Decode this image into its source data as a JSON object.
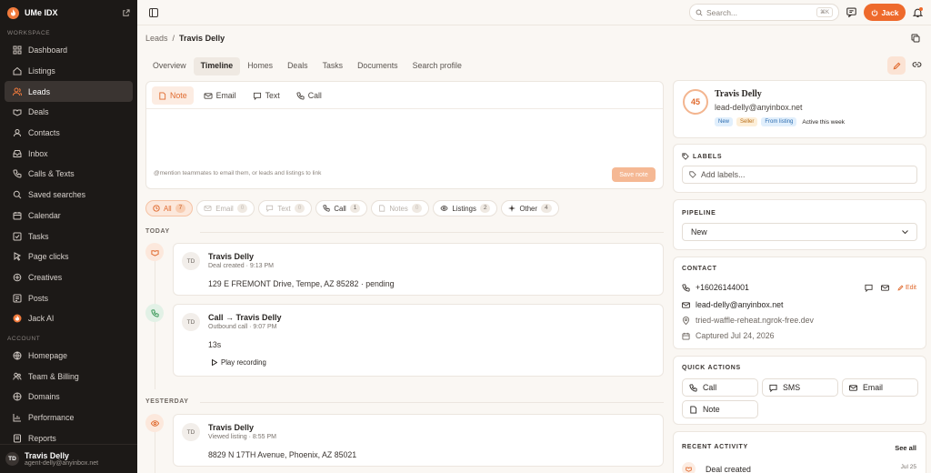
{
  "app": {
    "name": "UMe IDX"
  },
  "sidebar": {
    "workspace_label": "WORKSPACE",
    "account_label": "ACCOUNT",
    "items": [
      {
        "label": "Dashboard",
        "icon": "grid-icon"
      },
      {
        "label": "Listings",
        "icon": "home-icon"
      },
      {
        "label": "Leads",
        "icon": "users-icon",
        "active": true
      },
      {
        "label": "Deals",
        "icon": "handshake-icon"
      },
      {
        "label": "Contacts",
        "icon": "contact-icon"
      },
      {
        "label": "Inbox",
        "icon": "inbox-icon"
      },
      {
        "label": "Calls & Texts",
        "icon": "phone-icon"
      },
      {
        "label": "Saved searches",
        "icon": "search-icon"
      },
      {
        "label": "Calendar",
        "icon": "calendar-icon"
      },
      {
        "label": "Tasks",
        "icon": "check-icon"
      },
      {
        "label": "Page clicks",
        "icon": "cursor-icon"
      },
      {
        "label": "Creatives",
        "icon": "sparkle-icon"
      },
      {
        "label": "Posts",
        "icon": "post-icon"
      },
      {
        "label": "Jack AI",
        "icon": "flame-icon"
      }
    ],
    "account_items": [
      {
        "label": "Homepage",
        "icon": "globe-icon"
      },
      {
        "label": "Team & Billing",
        "icon": "team-icon"
      },
      {
        "label": "Domains",
        "icon": "domain-icon"
      },
      {
        "label": "Performance",
        "icon": "chart-icon"
      },
      {
        "label": "Reports",
        "icon": "report-icon"
      }
    ],
    "user": {
      "initials": "TD",
      "name": "Travis Delly",
      "email": "agent-delly@anyinbox.net"
    }
  },
  "topbar": {
    "search_placeholder": "Search...",
    "shortcut": "⌘K",
    "jack_label": "Jack"
  },
  "breadcrumb": {
    "parent": "Leads",
    "separator": "/",
    "current": "Travis Delly"
  },
  "tabs": [
    "Overview",
    "Timeline",
    "Homes",
    "Deals",
    "Tasks",
    "Documents",
    "Search profile"
  ],
  "active_tab": "Timeline",
  "composer": {
    "tabs": [
      "Note",
      "Email",
      "Text",
      "Call"
    ],
    "hint": "@mention teammates to email them, or leads and listings to link",
    "save_label": "Save note"
  },
  "filters": [
    {
      "label": "All",
      "count": "7"
    },
    {
      "label": "Email",
      "count": "0"
    },
    {
      "label": "Text",
      "count": "0"
    },
    {
      "label": "Call",
      "count": "1"
    },
    {
      "label": "Notes",
      "count": "0"
    },
    {
      "label": "Listings",
      "count": "2"
    },
    {
      "label": "Other",
      "count": "4"
    }
  ],
  "timeline": {
    "today_label": "TODAY",
    "yesterday_label": "YESTERDAY",
    "events": [
      {
        "initials": "TD",
        "title": "Travis Delly",
        "subtitle": "Deal created · 9:13 PM",
        "body": "129 E FREMONT Drive, Tempe, AZ 85282 · pending"
      },
      {
        "initials": "TD",
        "title": "Call → Travis Delly",
        "subtitle": "Outbound call · 9:07 PM",
        "body": "13s",
        "action": "Play recording"
      },
      {
        "initials": "TD",
        "title": "Travis Delly",
        "subtitle": "Viewed listing · 8:55 PM",
        "body": "8829 N 17TH Avenue, Phoenix, AZ 85021"
      }
    ]
  },
  "profile": {
    "score": "45",
    "name": "Travis Delly",
    "email": "lead-delly@anyinbox.net",
    "tags": [
      "New",
      "Seller",
      "From listing"
    ],
    "activity": "Active this week"
  },
  "labels": {
    "title": "LABELS",
    "placeholder": "Add labels..."
  },
  "pipeline": {
    "title": "PIPELINE",
    "value": "New"
  },
  "contact": {
    "title": "CONTACT",
    "phone": "+16026144001",
    "edit_label": "Edit",
    "email": "lead-delly@anyinbox.net",
    "website": "tried-waffle-reheat.ngrok-free.dev",
    "captured": "Captured Jul 24, 2026"
  },
  "quick_actions": {
    "title": "QUICK ACTIONS",
    "items": [
      "Call",
      "SMS",
      "Email",
      "Note"
    ]
  },
  "recent_activity": {
    "title": "RECENT ACTIVITY",
    "see_all": "See all",
    "item": "Deal created",
    "date": "Jul 25"
  },
  "colors": {
    "accent": "#ee6a2c",
    "sidebar_bg": "#1c1917",
    "page_bg": "#faf7f3"
  }
}
